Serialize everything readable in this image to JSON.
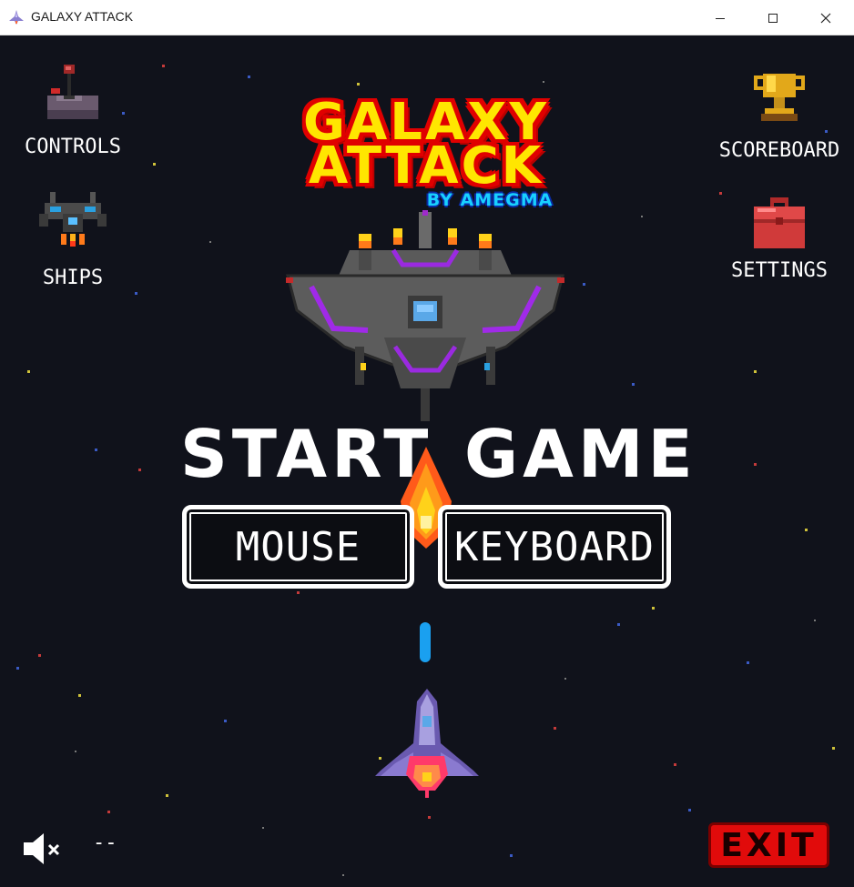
{
  "window": {
    "title": "GALAXY ATTACK",
    "app_icon": "spaceship-icon",
    "controls": [
      "minimize-icon",
      "maximize-icon",
      "close-icon"
    ]
  },
  "logo": {
    "line1": "GALAXY",
    "line2": "ATTACK",
    "byline": "BY AMEGMA",
    "colors": {
      "fill": "#ffe600",
      "outline": "#e00000",
      "byline": "#18d0ff"
    }
  },
  "menu": {
    "controls": {
      "label": "CONTROLS",
      "icon": "joystick-icon"
    },
    "ships": {
      "label": "SHIPS",
      "icon": "ship-icon"
    },
    "scoreboard": {
      "label": "SCOREBOARD",
      "icon": "trophy-icon"
    },
    "settings": {
      "label": "SETTINGS",
      "icon": "toolbox-icon"
    }
  },
  "start": {
    "word1": "START",
    "word2": "GAME",
    "mouse_label": "MOUSE",
    "keyboard_label": "KEYBOARD"
  },
  "footer": {
    "mute_icon": "speaker-muted-icon",
    "volume_text": "--",
    "exit_label": "EXIT"
  },
  "colors": {
    "background": "#10121b",
    "exit_button": "#e10b0b",
    "laser": "#1aa0f0"
  }
}
